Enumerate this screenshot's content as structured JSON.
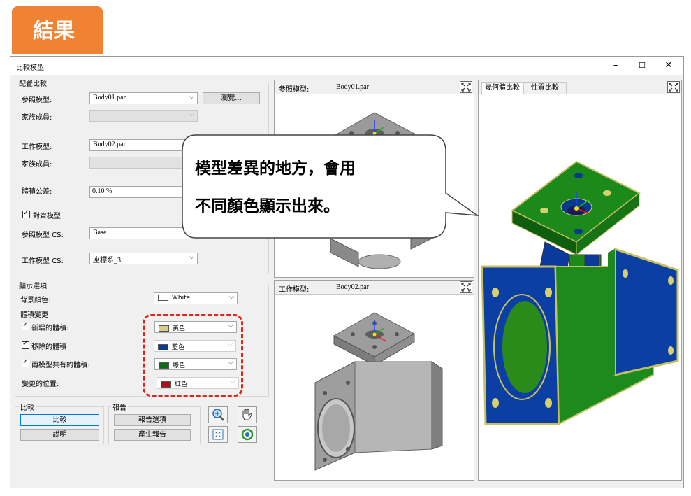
{
  "tag": {
    "title": "結果"
  },
  "window": {
    "title": "比較模型",
    "minimize": "–",
    "maximize": "☐",
    "close": "✕"
  },
  "config": {
    "group_label": "配置比較",
    "ref_model_label": "參照模型:",
    "ref_model_value": "Body01.par",
    "browse_button": "瀏覽...",
    "family1_label": "家族成員:",
    "work_model_label": "工作模型:",
    "work_model_value": "Body02.par",
    "family2_label": "家族成員:",
    "tolerance_label": "體積公差:",
    "tolerance_value": "0.10 %",
    "align_label": "對齊模型",
    "ref_cs_label": "參照模型 CS:",
    "ref_cs_value": "Base",
    "work_cs_label": "工作模型 CS:",
    "work_cs_value": "座標系_3"
  },
  "display": {
    "group_label": "顯示選項",
    "bg_label": "背景顏色:",
    "bg_value": "White",
    "bg_color": "#ffffff",
    "changes_label": "體積變更",
    "added_label": "新增的體積:",
    "added_value": "黃色",
    "added_color": "#d6cf8a",
    "removed_label": "移除的體積",
    "removed_value": "藍色",
    "removed_color": "#0b3b8f",
    "common_label": "兩模型共有的體積:",
    "common_value": "綠色",
    "common_color": "#0f6d18",
    "changed_label": "變更的位置:",
    "changed_value": "紅色",
    "changed_color": "#b00d18"
  },
  "compare": {
    "group_label": "比較",
    "compare_button": "比較",
    "explain_button": "說明"
  },
  "report": {
    "group_label": "報告",
    "options_button": "報告選項",
    "generate_button": "產生報告"
  },
  "viewports": {
    "ref_label": "參照模型:",
    "ref_file": "Body01.par",
    "work_label": "工作模型:",
    "work_file": "Body02.par",
    "tab_geometry": "幾何體比較",
    "tab_property": "性質比較"
  },
  "callout": {
    "line1": "模型差異的地方，會用",
    "line2": "不同顏色顯示出來。"
  }
}
